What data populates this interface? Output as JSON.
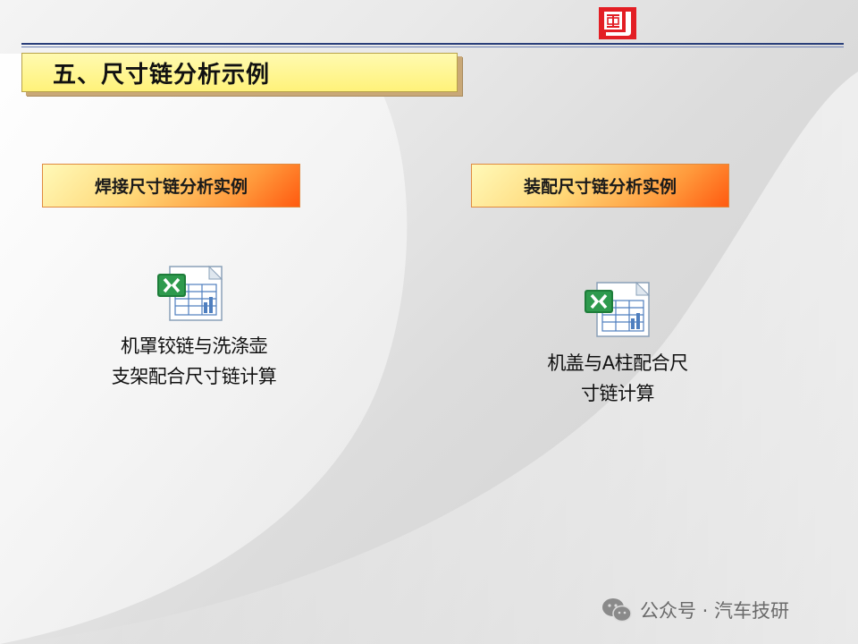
{
  "title": "五、尺寸链分析示例",
  "sections": [
    {
      "header": "焊接尺寸链分析实例",
      "file_caption_line1": "机罩铰链与洗涤壶",
      "file_caption_line2": "支架配合尺寸链计算",
      "icon": "excel-file-icon"
    },
    {
      "header": "装配尺寸链分析实例",
      "file_caption_line1": "机盖与A柱配合尺",
      "file_caption_line2": "寸链计算",
      "icon": "excel-file-icon"
    }
  ],
  "watermark": {
    "text": "公众号 · 汽车技研",
    "icon": "wechat-icon"
  },
  "colors": {
    "title_fill": "#fff27a",
    "rule_color": "#2a3f7a",
    "section_gradient_end": "#ff5a10",
    "logo_red": "#e31e24"
  }
}
